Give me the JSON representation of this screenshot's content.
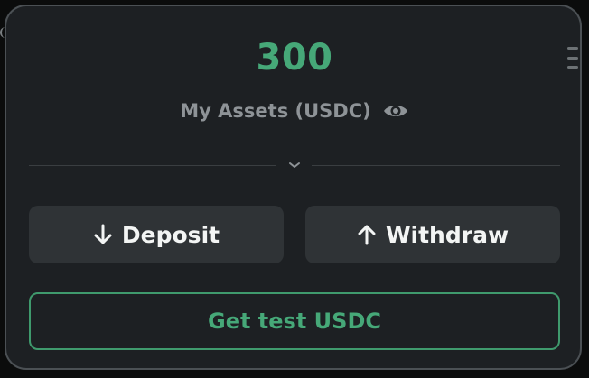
{
  "wallet": {
    "amount": "300",
    "assets_label": "My Assets (USDC)"
  },
  "icons": {
    "visibility": "eye-icon",
    "menu": "menu-icon",
    "expand": "chevron-down-icon",
    "deposit": "arrow-down-icon",
    "withdraw": "arrow-up-icon"
  },
  "actions": {
    "deposit_label": "Deposit",
    "withdraw_label": "Withdraw",
    "test_button_label": "Get test USDC"
  },
  "colors": {
    "accent": "#46a878",
    "card_background": "#1d2023",
    "button_background": "#2f3336"
  }
}
